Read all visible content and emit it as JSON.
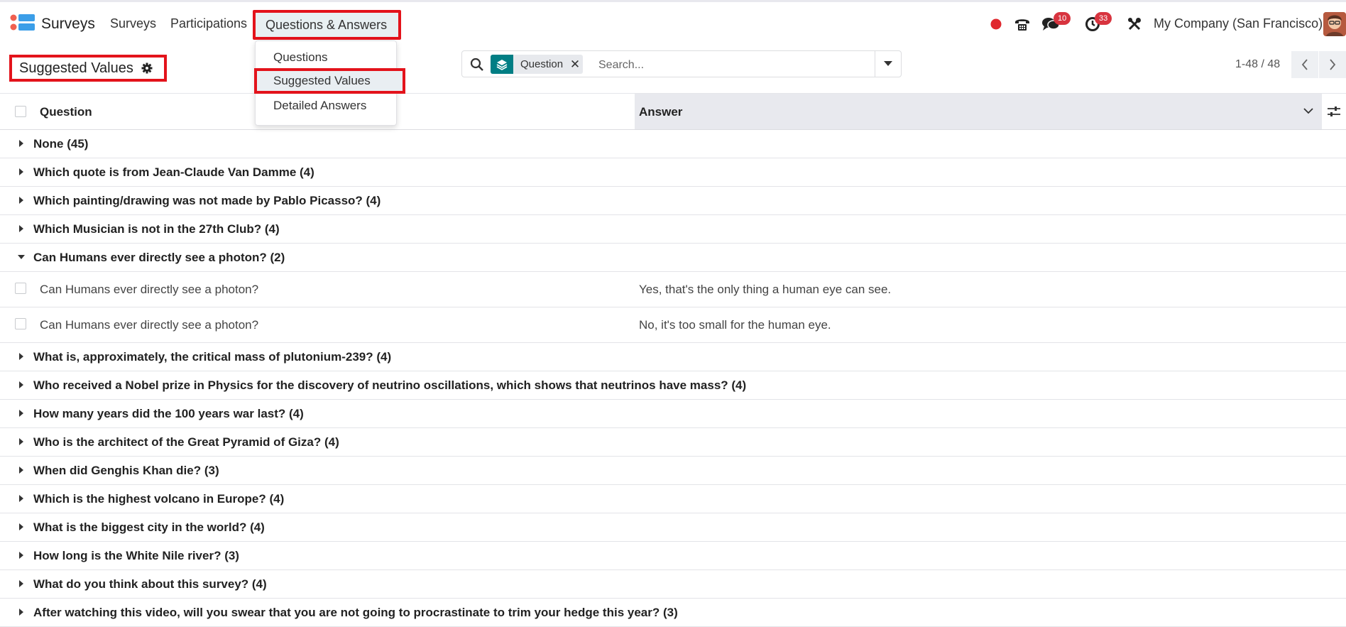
{
  "navbar": {
    "app_title": "Surveys",
    "menus": [
      "Surveys",
      "Participations",
      "Questions & Answers"
    ],
    "messages_badge": "10",
    "activities_badge": "33",
    "company": "My Company (San Francisco)"
  },
  "dropdown": {
    "items": [
      "Questions",
      "Suggested Values",
      "Detailed Answers"
    ]
  },
  "control_panel": {
    "breadcrumb": "Suggested Values",
    "facet_label": "Question",
    "search_placeholder": "Search...",
    "pager_value": "1-48 / 48"
  },
  "list": {
    "columns": [
      "Question",
      "Answer"
    ],
    "groups": [
      "None (45)",
      "Which quote is from Jean-Claude Van Damme (4)",
      "Which painting/drawing was not made by Pablo Picasso? (4)",
      "Which Musician is not in the 27th Club? (4)",
      "Can Humans ever directly see a photon? (2)",
      "What is, approximately, the critical mass of plutonium-239? (4)",
      "Who received a Nobel prize in Physics for the discovery of neutrino oscillations, which shows that neutrinos have mass? (4)",
      "How many years did the 100 years war last? (4)",
      "Who is the architect of the Great Pyramid of Giza? (4)",
      "When did Genghis Khan die? (3)",
      "Which is the highest volcano in Europe? (4)",
      "What is the biggest city in the world? (4)",
      "How long is the White Nile river? (3)",
      "What do you think about this survey? (4)",
      "After watching this video, will you swear that you are not going to procrastinate to trim your hedge this year? (3)"
    ],
    "expanded_rows": [
      {
        "question": "Can Humans ever directly see a photon?",
        "answer": "Yes, that's the only thing a human eye can see."
      },
      {
        "question": "Can Humans ever directly see a photon?",
        "answer": "No, it's too small for the human eye."
      }
    ]
  },
  "colors": {
    "highlight": "#e3131b",
    "facet_accent": "#017e84",
    "badge": "#d8343f",
    "record_dot": "#e0282e"
  }
}
